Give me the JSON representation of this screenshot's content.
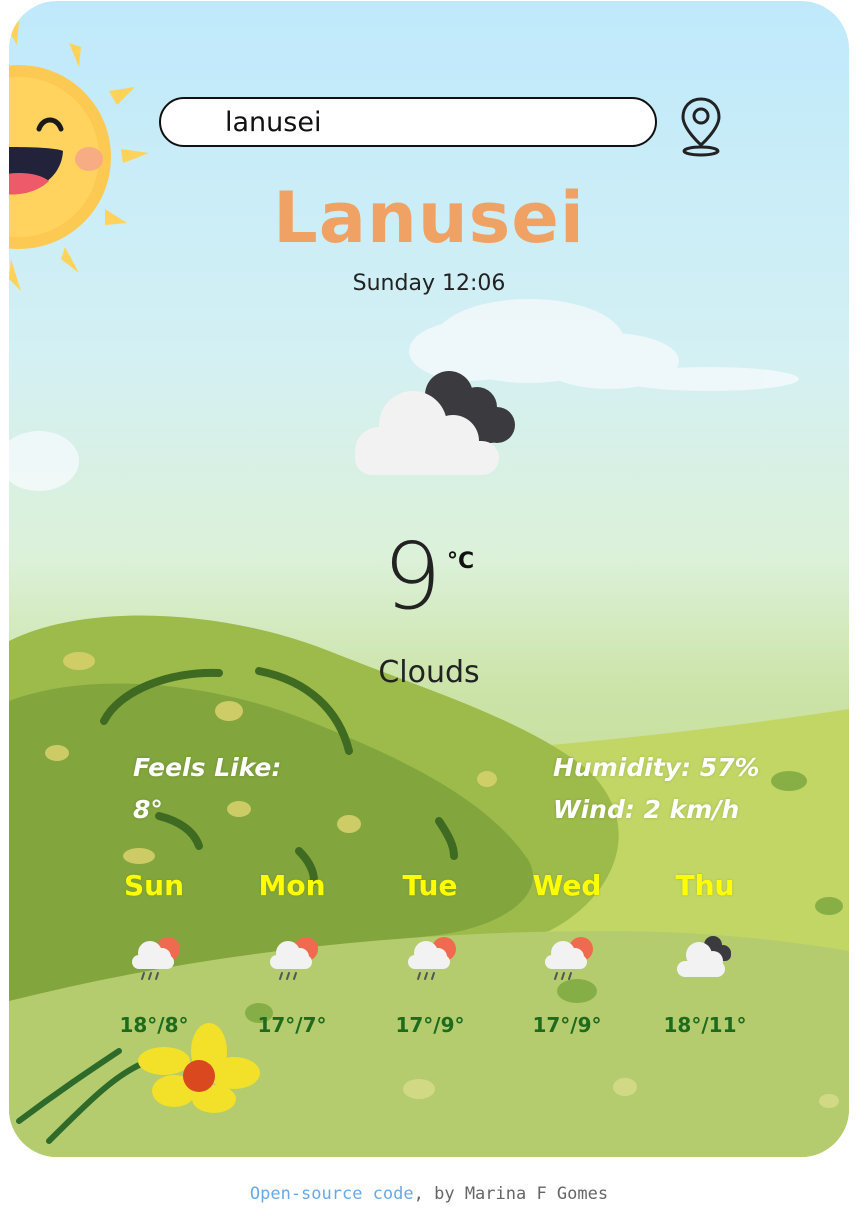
{
  "search": {
    "value": "lanusei"
  },
  "location_button": {
    "icon": "map-pin-icon"
  },
  "current": {
    "city": "Lanusei",
    "datetime": "Sunday 12:06",
    "icon": "cloudy-icon",
    "temperature": "9",
    "unit": "°C",
    "condition": "Clouds"
  },
  "details": {
    "feels_like_label": "Feels Like:",
    "feels_like_value": "8°",
    "humidity": "Humidity: 57%",
    "wind": "Wind: 2 km/h"
  },
  "forecast": [
    {
      "day": "Sun",
      "range": "18°/8°",
      "icon": "rain-sun-icon"
    },
    {
      "day": "Mon",
      "range": "17°/7°",
      "icon": "rain-sun-icon"
    },
    {
      "day": "Tue",
      "range": "17°/9°",
      "icon": "rain-sun-icon"
    },
    {
      "day": "Wed",
      "range": "17°/9°",
      "icon": "rain-sun-icon"
    },
    {
      "day": "Thu",
      "range": "18°/11°",
      "icon": "cloudy-icon"
    }
  ],
  "footer": {
    "link_text": "Open-source code",
    "suffix": ", by Marina F Gomes"
  },
  "colors": {
    "city": "#f0a265",
    "day_labels": "#ffff00",
    "temp_ranges": "#1e6b1e",
    "footer_link": "#6aa9e8"
  }
}
